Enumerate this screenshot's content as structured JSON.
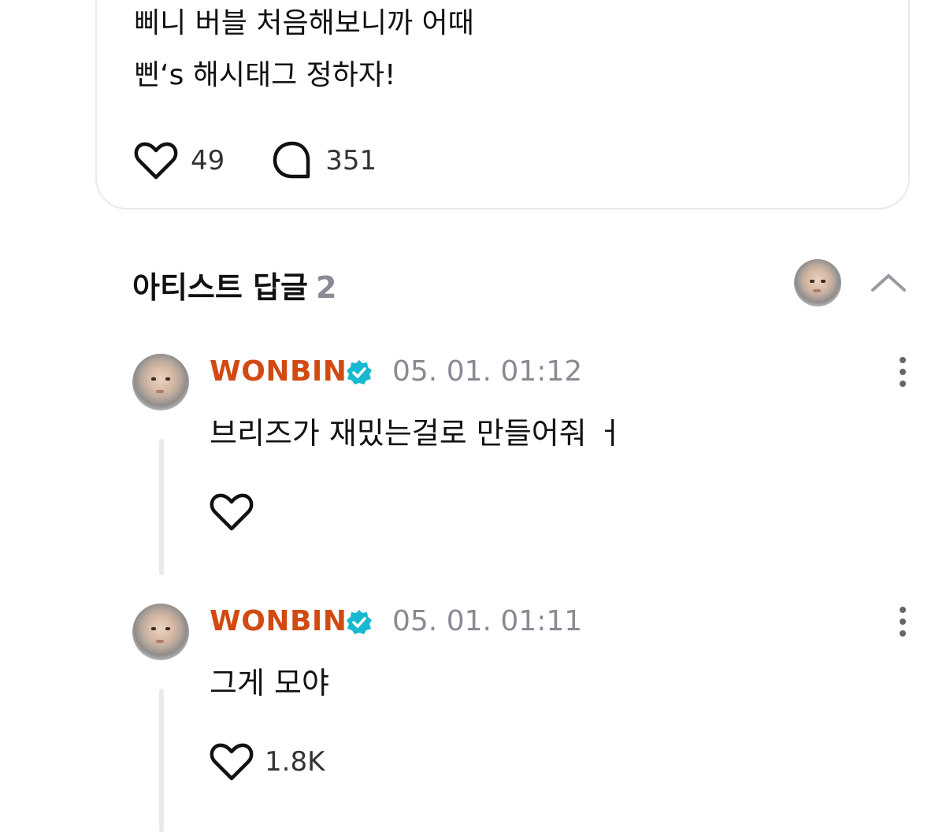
{
  "post": {
    "line1": "삐니 버블 처음해보니까 어때",
    "line2": "삔‘s 해시태그 정하자!",
    "like_count": "49",
    "comment_count": "351"
  },
  "artist_replies": {
    "title": "아티스트 답글",
    "count": "2"
  },
  "replies": [
    {
      "author": "WONBIN",
      "timestamp": "05. 01. 01:12",
      "text": "브리즈가 재밌는걸로 만들어줘 ㅓ",
      "like_count": ""
    },
    {
      "author": "WONBIN",
      "timestamp": "05. 01. 01:11",
      "text": "그게 모야",
      "like_count": "1.8K"
    }
  ],
  "colors": {
    "author_name": "#d24a11",
    "verified_badge": "#17b9d0",
    "meta_gray": "#8a8a94",
    "thread_line": "#e8e8ed"
  },
  "icons": [
    "heart-icon",
    "comment-bubble-icon",
    "chevron-up-icon",
    "verified-badge-icon",
    "more-vertical-icon"
  ]
}
